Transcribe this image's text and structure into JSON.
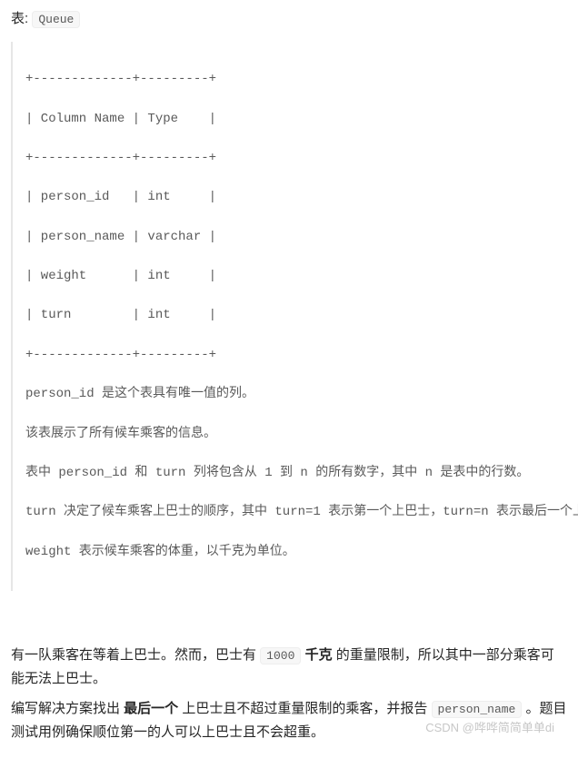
{
  "header": {
    "prefix": "表: ",
    "tableName": "Queue"
  },
  "schema": {
    "border_top": "+-------------+---------+",
    "header_row": "| Column Name | Type    |",
    "border_mid": "+-------------+---------+",
    "rows": [
      "| person_id   | int     |",
      "| person_name | varchar |",
      "| weight      | int     |",
      "| turn        | int     |"
    ],
    "border_bot": "+-------------+---------+",
    "desc_lines": [
      "person_id 是这个表具有唯一值的列。",
      "该表展示了所有候车乘客的信息。",
      "表中 person_id 和 turn 列将包含从 1 到 n 的所有数字，其中 n 是表中的行数。",
      "turn 决定了候车乘客上巴士的顺序，其中 turn=1 表示第一个上巴士，turn=n 表示最后一个上巴士。",
      "weight 表示候车乘客的体重，以千克为单位。"
    ]
  },
  "body": {
    "p1_a": "有一队乘客在等着上巴士。然而，巴士有 ",
    "weight_limit": "1000",
    "p1_b": " ",
    "p1_bold1": "千克",
    "p1_c": " 的重量限制，所以其中一部分乘客可能无法上巴士。",
    "p2_a": "编写解决方案找出 ",
    "p2_bold": "最后一个",
    "p2_b": " 上巴士且不超过重量限制的乘客，并报告 ",
    "p2_code": "person_name",
    "p2_c": " 。题目测试用例确保顺位第一的人可以上巴士且不会超重。"
  },
  "watermark": "CSDN @哗哗简简单单di"
}
